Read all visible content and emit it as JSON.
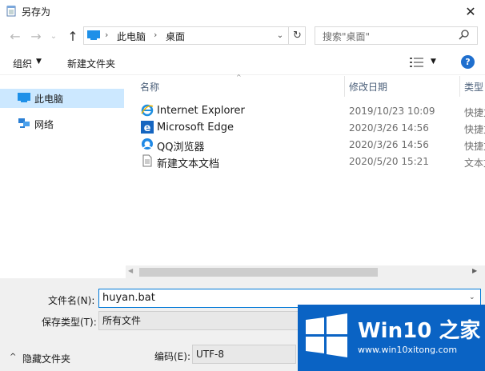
{
  "window": {
    "title": "另存为",
    "close_glyph": "✕"
  },
  "nav": {
    "back_glyph": "←",
    "forward_glyph": "→",
    "recent_glyph": "⌄",
    "up_glyph": "↑"
  },
  "address": {
    "breadcrumbs": [
      "此电脑",
      "桌面"
    ],
    "sep_glyph": "›",
    "dropdown_glyph": "⌄",
    "refresh_glyph": "↻"
  },
  "search": {
    "placeholder": "搜索\"桌面\""
  },
  "toolbar": {
    "organize_label": "组织",
    "organize_caret": "▼",
    "new_folder_label": "新建文件夹",
    "view_caret": "▼",
    "help_label": "?"
  },
  "sidebar": {
    "items": [
      {
        "label": "此电脑",
        "icon": "pc-icon",
        "selected": true
      },
      {
        "label": "网络",
        "icon": "network-icon",
        "selected": false
      }
    ]
  },
  "filelist": {
    "sort_glyph": "^",
    "columns": {
      "name": "名称",
      "date": "修改日期",
      "type": "类型"
    },
    "rows": [
      {
        "name": "Internet Explorer",
        "date": "2019/10/23 10:09",
        "type": "快捷方式",
        "icon": "ie-icon"
      },
      {
        "name": "Microsoft Edge",
        "date": "2020/3/26 14:56",
        "type": "快捷方式",
        "icon": "edge-icon"
      },
      {
        "name": "QQ浏览器",
        "date": "2020/3/26 14:56",
        "type": "快捷方式",
        "icon": "qq-browser-icon"
      },
      {
        "name": "新建文本文档",
        "date": "2020/5/20 15:21",
        "type": "文本文档",
        "icon": "text-file-icon"
      }
    ]
  },
  "scroll": {
    "left_glyph": "◀",
    "right_glyph": "▶"
  },
  "form": {
    "filename_label": "文件名(N):",
    "filename_value": "huyan.bat",
    "filename_caret": "⌄",
    "savetype_label": "保存类型(T):",
    "savetype_value": "所有文件",
    "hide_caret": "^",
    "hide_folders_label": "隐藏文件夹",
    "encoding_label": "编码(E):",
    "encoding_value": "UTF-8"
  },
  "watermark": {
    "title": "Win10 之家",
    "url": "www.win10xitong.com"
  },
  "colors": {
    "accent": "#0078d7",
    "selection": "#cce8ff",
    "watermark_bg": "#0a63c4"
  }
}
